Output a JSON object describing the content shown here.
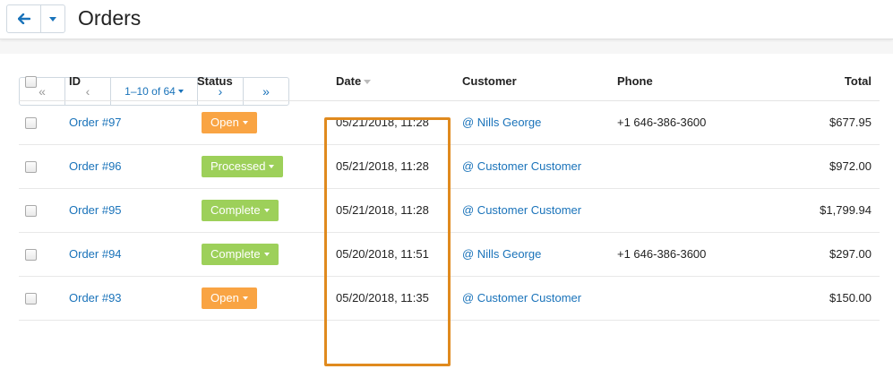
{
  "header": {
    "title": "Orders"
  },
  "pagination": {
    "first": "«",
    "prev": "‹",
    "range": "1–10 of 64",
    "next": "›",
    "last": "»"
  },
  "columns": {
    "id": "ID",
    "status": "Status",
    "date": "Date",
    "customer": "Customer",
    "phone": "Phone",
    "total": "Total"
  },
  "orders": [
    {
      "id": "Order #97",
      "status": "Open",
      "status_color": "#f9a443",
      "date": "05/21/2018, 11:28",
      "customer": "@ Nills George",
      "phone": "+1 646-386-3600",
      "total": "$677.95"
    },
    {
      "id": "Order #96",
      "status": "Processed",
      "status_color": "#9dd05a",
      "date": "05/21/2018, 11:28",
      "customer": "@ Customer Customer",
      "phone": "",
      "total": "$972.00"
    },
    {
      "id": "Order #95",
      "status": "Complete",
      "status_color": "#9dd05a",
      "date": "05/21/2018, 11:28",
      "customer": "@ Customer Customer",
      "phone": "",
      "total": "$1,799.94"
    },
    {
      "id": "Order #94",
      "status": "Complete",
      "status_color": "#9dd05a",
      "date": "05/20/2018, 11:51",
      "customer": "@ Nills George",
      "phone": "+1 646-386-3600",
      "total": "$297.00"
    },
    {
      "id": "Order #93",
      "status": "Open",
      "status_color": "#f9a443",
      "date": "05/20/2018, 11:35",
      "customer": "@ Customer Customer",
      "phone": "",
      "total": "$150.00"
    }
  ],
  "colors": {
    "accent": "#1a73ba",
    "highlight": "#e08a1e"
  }
}
